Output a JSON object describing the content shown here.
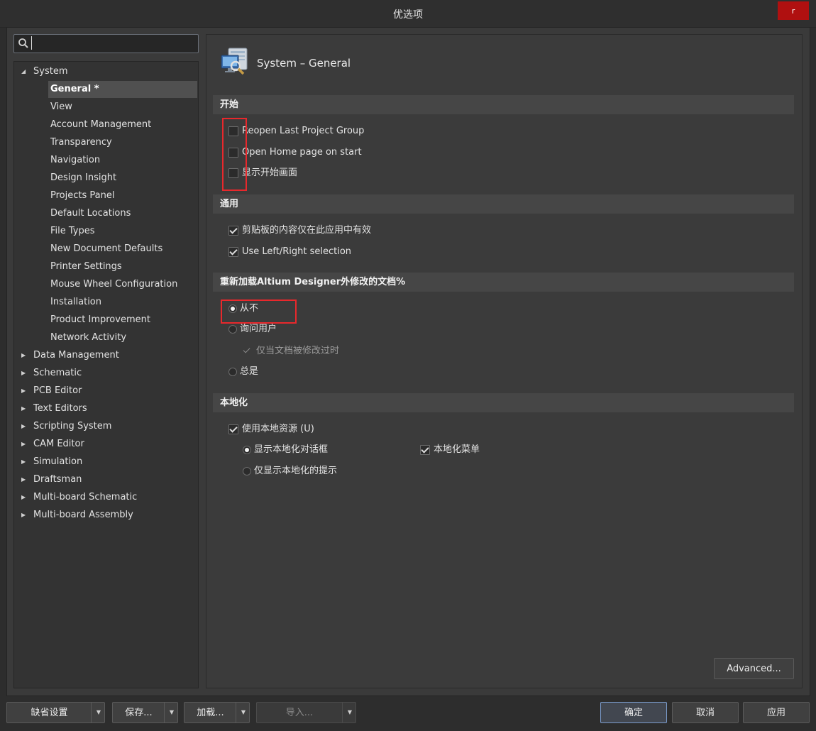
{
  "window": {
    "title": "优选项",
    "close_label": "r"
  },
  "search": {
    "placeholder": "",
    "value": ""
  },
  "tree": {
    "items": [
      {
        "label": "System",
        "level": 0,
        "expanded": true
      },
      {
        "label": "General *",
        "level": 1,
        "selected": true
      },
      {
        "label": "View",
        "level": 1
      },
      {
        "label": "Account Management",
        "level": 1
      },
      {
        "label": "Transparency",
        "level": 1
      },
      {
        "label": "Navigation",
        "level": 1
      },
      {
        "label": "Design Insight",
        "level": 1
      },
      {
        "label": "Projects Panel",
        "level": 1
      },
      {
        "label": "Default Locations",
        "level": 1
      },
      {
        "label": "File Types",
        "level": 1
      },
      {
        "label": "New Document Defaults",
        "level": 1
      },
      {
        "label": "Printer Settings",
        "level": 1
      },
      {
        "label": "Mouse Wheel Configuration",
        "level": 1
      },
      {
        "label": "Installation",
        "level": 1
      },
      {
        "label": "Product Improvement",
        "level": 1
      },
      {
        "label": "Network Activity",
        "level": 1
      },
      {
        "label": "Data Management",
        "level": 0
      },
      {
        "label": "Schematic",
        "level": 0
      },
      {
        "label": "PCB Editor",
        "level": 0
      },
      {
        "label": "Text Editors",
        "level": 0
      },
      {
        "label": "Scripting System",
        "level": 0
      },
      {
        "label": "CAM Editor",
        "level": 0
      },
      {
        "label": "Simulation",
        "level": 0
      },
      {
        "label": "Draftsman",
        "level": 0
      },
      {
        "label": "Multi-board Schematic",
        "level": 0
      },
      {
        "label": "Multi-board Assembly",
        "level": 0
      }
    ]
  },
  "panel": {
    "title": "System – General",
    "startup": {
      "header": "开始",
      "reopen_last_project_group": {
        "label": "Reopen Last Project Group",
        "checked": false
      },
      "open_home_page": {
        "label": "Open Home page on start",
        "checked": false
      },
      "show_start_screen": {
        "label": "显示开始画面",
        "checked": false
      }
    },
    "general": {
      "header": "通用",
      "clipboard_only": {
        "label": "剪贴板的内容仅在此应用中有效",
        "checked": true
      },
      "left_right_selection": {
        "label": "Use Left/Right selection",
        "checked": true
      }
    },
    "reload": {
      "header": "重新加载Altium Designer外修改的文档%",
      "never": {
        "label": "从不",
        "selected": true
      },
      "ask_user": {
        "label": "询问用户",
        "selected": false
      },
      "only_if_modified": {
        "label": "仅当文档被修改过时",
        "checked": true,
        "enabled": false
      },
      "always": {
        "label": "总是",
        "selected": false
      }
    },
    "localization": {
      "header": "本地化",
      "use_local_resources": {
        "label": "使用本地资源 (U)",
        "checked": true
      },
      "show_localized_dialogs": {
        "label": "显示本地化对话框",
        "selected": true
      },
      "localized_menus": {
        "label": "本地化菜单",
        "checked": true
      },
      "show_localized_hints_only": {
        "label": "仅显示本地化的提示",
        "selected": false
      }
    },
    "advanced_label": "Advanced..."
  },
  "footer": {
    "defaults_label": "缺省设置",
    "save_label": "保存...",
    "load_label": "加载...",
    "import_label": "导入...",
    "ok_label": "确定",
    "cancel_label": "取消",
    "apply_label": "应用"
  },
  "colors": {
    "background": "#2d2d2d",
    "panel": "#3b3b3b",
    "section_header": "#464646",
    "highlight_box": "#e8282c",
    "close_button": "#b01010",
    "primary_border": "#7b9ccd"
  }
}
